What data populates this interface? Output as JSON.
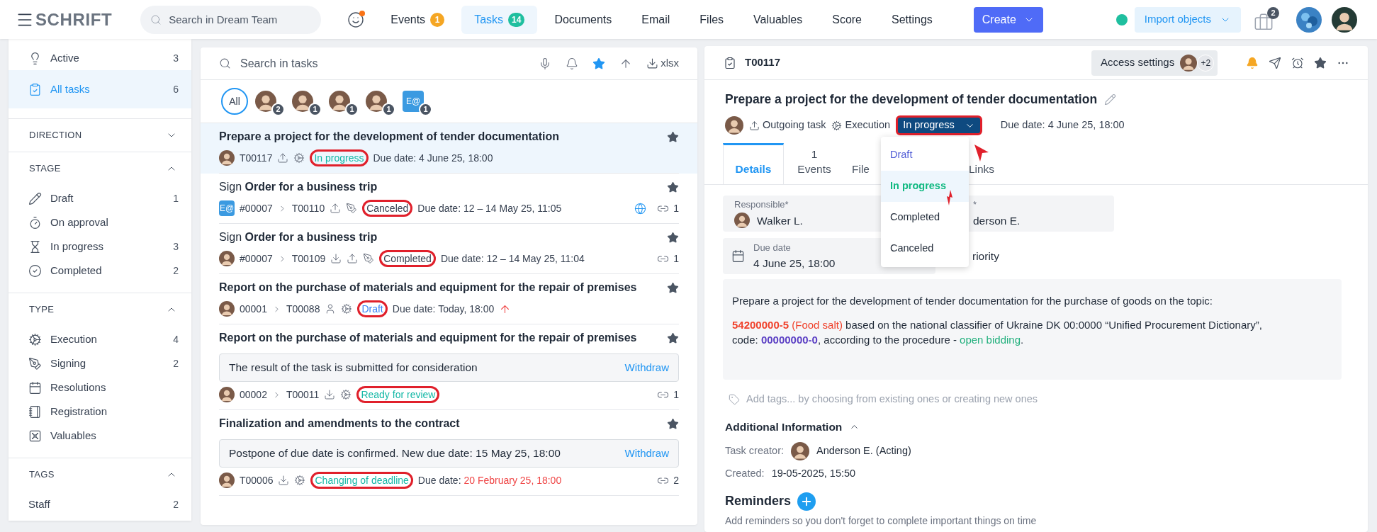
{
  "topbar": {
    "logo": "SCHRIFT",
    "search": {
      "placeholder": "Search in Dream Team"
    },
    "nav": [
      {
        "label": "Events",
        "badge": "1",
        "color": "#f5a623",
        "selected": false
      },
      {
        "label": "Tasks",
        "badge": "14",
        "color": "#1fbf9f",
        "selected": true
      },
      {
        "label": "Documents",
        "selected": false
      },
      {
        "label": "Email",
        "selected": false
      },
      {
        "label": "Files",
        "selected": false
      },
      {
        "label": "Valuables",
        "selected": false
      },
      {
        "label": "Score",
        "selected": false
      },
      {
        "label": "Settings",
        "selected": false
      }
    ],
    "create": "Create",
    "online": true,
    "import": "Import objects",
    "briefcase_badge": "2"
  },
  "sidebar": {
    "views": [
      {
        "kind": "active",
        "label": "Active",
        "count": "3",
        "selected": false
      },
      {
        "kind": "all",
        "label": "All tasks",
        "count": "6",
        "selected": true
      }
    ],
    "sections": [
      {
        "title": "DIRECTION",
        "expanded": false
      },
      {
        "title": "STAGE",
        "expanded": true,
        "items": [
          {
            "kind": "draft",
            "label": "Draft",
            "count": "1"
          },
          {
            "kind": "approval",
            "label": "On approval"
          },
          {
            "kind": "progress",
            "label": "In progress",
            "count": "3"
          },
          {
            "kind": "completed",
            "label": "Completed",
            "count": "2"
          }
        ]
      },
      {
        "title": "TYPE",
        "expanded": true,
        "items": [
          {
            "kind": "execution",
            "label": "Execution",
            "count": "4"
          },
          {
            "kind": "signing",
            "label": "Signing",
            "count": "2"
          },
          {
            "kind": "resolutions",
            "label": "Resolutions"
          },
          {
            "kind": "registration",
            "label": "Registration"
          },
          {
            "kind": "valuables",
            "label": "Valuables"
          }
        ]
      },
      {
        "title": "TAGS",
        "expanded": true,
        "items": [
          {
            "kind": "tag",
            "label": "Staff",
            "count": "2"
          }
        ]
      }
    ]
  },
  "tasklist": {
    "search": {
      "placeholder": "Search in tasks"
    },
    "favorites_on": true,
    "export": "xlsx",
    "filters": [
      {
        "kind": "all",
        "label": "All",
        "selected": true
      },
      {
        "kind": "person",
        "count": "2",
        "selected": false
      },
      {
        "kind": "person",
        "count": "1",
        "selected": false
      },
      {
        "kind": "person",
        "count": "1",
        "selected": false
      },
      {
        "kind": "person",
        "count": "1",
        "selected": false
      },
      {
        "kind": "email",
        "label": "E@",
        "count": "1",
        "selected": false
      }
    ],
    "tasks": [
      {
        "kind": "execution",
        "title": "Prepare a project for the development of tender documentation",
        "selected": true,
        "sender": {
          "kind": "person"
        },
        "path": [
          "T00117"
        ],
        "flow": [
          {
            "kind": "out"
          }
        ],
        "status": {
          "label": "In progress",
          "color": "#14b8a6"
        },
        "due_label": "Due date:",
        "due": "4 June 25, 18:00",
        "overdue": false
      },
      {
        "kind": "signing",
        "title": "Sign **Order for a business trip**",
        "selected": false,
        "sender": {
          "kind": "email",
          "label": "E@"
        },
        "path": [
          "#00007",
          "T00110"
        ],
        "flow": [
          {
            "kind": "out"
          }
        ],
        "status": {
          "label": "Canceled",
          "color": "#374151"
        },
        "due_label": "Due date:",
        "due": "12 – 14 May 25, 11:05",
        "overdue": false,
        "web": true,
        "links": "1"
      },
      {
        "kind": "signing",
        "title": "Sign **Order for a business trip**",
        "selected": false,
        "sender": {
          "kind": "person"
        },
        "path": [
          "#00007",
          "T00109"
        ],
        "flow": [
          {
            "kind": "in"
          },
          {
            "kind": "out"
          }
        ],
        "status": {
          "label": "Completed",
          "color": "#374151"
        },
        "due_label": "Due date:",
        "due": "12 – 14 May 25, 11:04",
        "overdue": false,
        "links": "1"
      },
      {
        "kind": "execution",
        "title": "Report on the purchase of materials and equipment for the repair of premises",
        "selected": false,
        "sender": {
          "kind": "person"
        },
        "path": [
          "00001",
          "T00088"
        ],
        "flow": [
          {
            "kind": "user"
          }
        ],
        "status": {
          "label": "Draft",
          "color": "#3b82f6"
        },
        "due_label": "Due date:",
        "due": "Today, 18:00",
        "overdue": false,
        "urgent": true
      },
      {
        "kind": "execution",
        "title": "Report on the purchase of materials and equipment for the repair of premises",
        "selected": false,
        "message": "The result of the task is submitted for consideration",
        "action": "Withdraw",
        "sender": {
          "kind": "person"
        },
        "path": [
          "00002",
          "T00011"
        ],
        "flow": [
          {
            "kind": "in"
          }
        ],
        "status": {
          "label": "Ready for review",
          "color": "#14b8a6"
        },
        "links": "1"
      },
      {
        "kind": "execution",
        "title": "Finalization and amendments to the contract",
        "selected": false,
        "message": "Postpone of due date is confirmed. New due date: 15 May 25, 18:00",
        "action": "Withdraw",
        "sender": {
          "kind": "person"
        },
        "path": [
          "T00006"
        ],
        "flow": [
          {
            "kind": "in"
          }
        ],
        "status": {
          "label": "Changing of deadline",
          "color": "#14b8a6"
        },
        "due_label": "Due date:",
        "due": "20 February 25, 18:00",
        "overdue": true,
        "links": "2"
      }
    ]
  },
  "detail": {
    "id": "T00117",
    "access": {
      "label": "Access settings",
      "extra": "+2"
    },
    "notifications": true,
    "title": "Prepare a project for the development of tender documentation",
    "direction": "Outgoing task",
    "type": "Execution",
    "status": "In progress",
    "due": "Due date: 4 June 25, 18:00",
    "tabs": [
      {
        "label": "Details",
        "selected": true
      },
      {
        "count": "1",
        "label": "Events",
        "selected": false
      },
      {
        "label": "File",
        "selected": false
      },
      {
        "label": "Links",
        "selected": false
      }
    ],
    "status_menu": [
      {
        "label": "Draft",
        "color": "#4f5bd5",
        "selected": false
      },
      {
        "label": "In progress",
        "color": "#10b981",
        "selected": true
      },
      {
        "label": "Completed",
        "color": "#1f2937",
        "selected": false
      },
      {
        "label": "Canceled",
        "color": "#1f2937",
        "selected": false
      }
    ],
    "responsible": {
      "label": "Responsible*",
      "value": "Walker L."
    },
    "controller": {
      "label": "*",
      "value": "derson E."
    },
    "due_field": {
      "label": "Due date",
      "value": "4 June 25, 18:00"
    },
    "priority": {
      "value": "riority"
    },
    "description": {
      "intro": "Prepare a project for the development of tender documentation for the purchase of goods on the topic:",
      "lines": [
        [
          {
            "kind": "accent",
            "text": "54200000-5"
          },
          {
            "kind": "note",
            "text": " (Food salt)"
          },
          {
            "kind": "plain",
            "text": " based on the national classifier of Ukraine DK 00:0000 “Unified Procurement Dictionary”,"
          }
        ],
        [
          {
            "kind": "plain",
            "text": "code: "
          },
          {
            "kind": "code",
            "text": "00000000-0"
          },
          {
            "kind": "plain",
            "text": ", according to the procedure - "
          },
          {
            "kind": "link",
            "text": "open bidding"
          },
          {
            "kind": "plain",
            "text": "."
          }
        ]
      ]
    },
    "tags_placeholder": "Add tags... by choosing from existing ones or creating new ones",
    "additional": {
      "title": "Additional Information",
      "expanded": true,
      "creator_label": "Task creator:",
      "creator": "Anderson E. (Acting)",
      "created_label": "Created:",
      "created": "19-05-2025, 15:50"
    },
    "reminders": {
      "title": "Reminders",
      "hint": "Add reminders so you don't forget to complete important things on time"
    }
  }
}
